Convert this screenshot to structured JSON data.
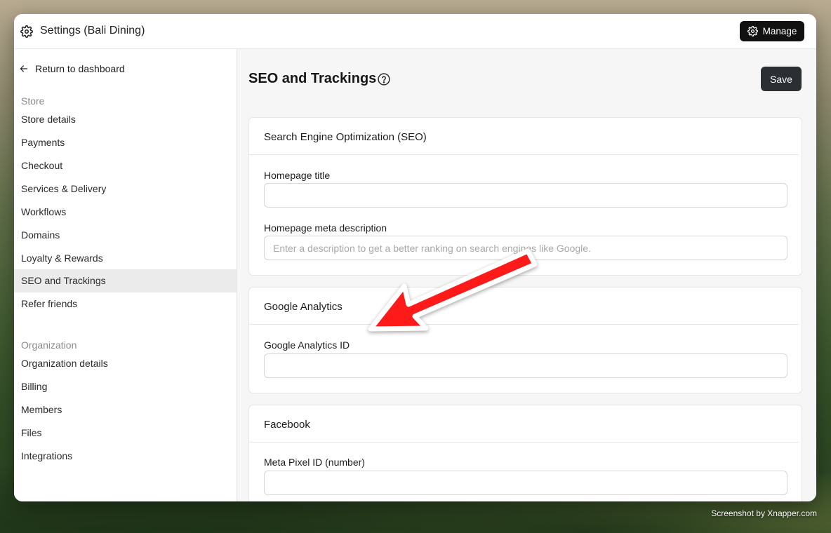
{
  "window": {
    "title": "Settings (Bali Dining)",
    "manage_label": "Manage"
  },
  "sidebar": {
    "return_label": "Return to dashboard",
    "store_section": "Store",
    "store_items": [
      {
        "label": "Store details"
      },
      {
        "label": "Payments"
      },
      {
        "label": "Checkout"
      },
      {
        "label": "Services & Delivery"
      },
      {
        "label": "Workflows"
      },
      {
        "label": "Domains"
      },
      {
        "label": "Loyalty & Rewards"
      },
      {
        "label": "SEO and Trackings",
        "active": true
      },
      {
        "label": "Refer friends"
      }
    ],
    "org_section": "Organization",
    "org_items": [
      {
        "label": "Organization details"
      },
      {
        "label": "Billing"
      },
      {
        "label": "Members"
      },
      {
        "label": "Files"
      },
      {
        "label": "Integrations"
      }
    ]
  },
  "main": {
    "page_title": "SEO and Trackings",
    "save_label": "Save",
    "seo": {
      "header": "Search Engine Optimization (SEO)",
      "homepage_title_label": "Homepage title",
      "homepage_title_value": "",
      "meta_desc_label": "Homepage meta description",
      "meta_desc_placeholder": "Enter a description to get a better ranking on search engines like Google."
    },
    "ga": {
      "header": "Google Analytics",
      "id_label": "Google Analytics ID",
      "id_value": ""
    },
    "facebook": {
      "header": "Facebook",
      "pixel_label": "Meta Pixel ID (number)",
      "pixel_value": ""
    }
  },
  "annotation": {
    "arrow_color": "#ff1a1a"
  },
  "watermark": "Screenshot by Xnapper.com"
}
